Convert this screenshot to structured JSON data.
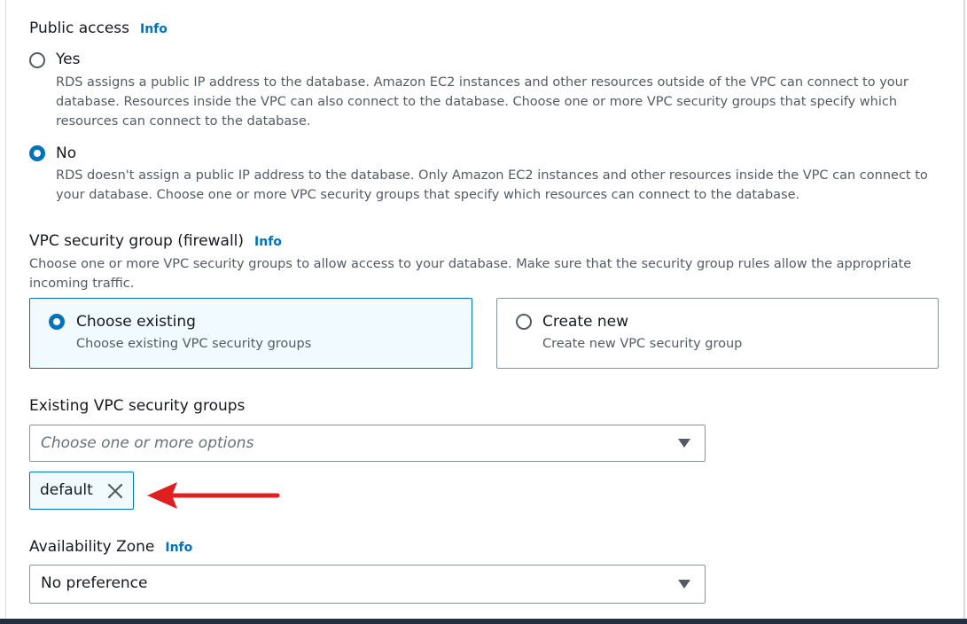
{
  "public_access": {
    "title": "Public access",
    "info_label": "Info",
    "options": [
      {
        "label": "Yes",
        "selected": false,
        "description": "RDS assigns a public IP address to the database. Amazon EC2 instances and other resources outside of the VPC can connect to your database. Resources inside the VPC can also connect to the database. Choose one or more VPC security groups that specify which resources can connect to the database."
      },
      {
        "label": "No",
        "selected": true,
        "description": "RDS doesn't assign a public IP address to the database. Only Amazon EC2 instances and other resources inside the VPC can connect to your database. Choose one or more VPC security groups that specify which resources can connect to the database."
      }
    ]
  },
  "vpc_security_group": {
    "title": "VPC security group (firewall)",
    "info_label": "Info",
    "description": "Choose one or more VPC security groups to allow access to your database. Make sure that the security group rules allow the appropriate incoming traffic.",
    "tiles": [
      {
        "label": "Choose existing",
        "description": "Choose existing VPC security groups",
        "selected": true
      },
      {
        "label": "Create new",
        "description": "Create new VPC security group",
        "selected": false
      }
    ]
  },
  "existing_groups": {
    "label": "Existing VPC security groups",
    "placeholder": "Choose one or more options",
    "tokens": [
      "default"
    ],
    "remove_icon": "close-icon"
  },
  "annotation": {
    "arrow_color": "#e02020"
  },
  "availability_zone": {
    "title": "Availability Zone",
    "info_label": "Info",
    "value": "No preference"
  },
  "colors": {
    "accent": "#0073bb",
    "text": "#16191f",
    "secondary_text": "#545b64",
    "selected_tile_bg": "#f1faff"
  }
}
